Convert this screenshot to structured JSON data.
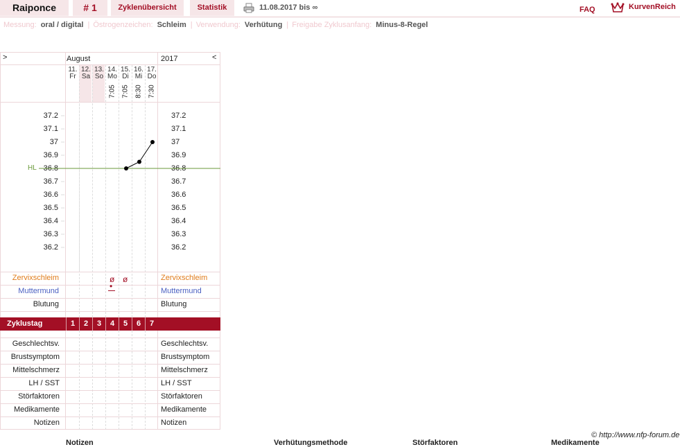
{
  "nav": {
    "user": "Raiponce",
    "cycle_number": "# 1",
    "tab_overview": "Zyklenübersicht",
    "tab_stats": "Statistik",
    "date_range": "11.08.2017 bis ∞",
    "faq": "FAQ",
    "brand": "KurvenReich"
  },
  "info": {
    "measure_label": "Messung:",
    "measure_value": "oral / digital",
    "estrogen_label": "Östrogenzeichen:",
    "estrogen_value": "Schleim",
    "use_label": "Verwendung:",
    "use_value": "Verhütung",
    "release_label": "Freigabe Zyklusanfang:",
    "release_value": "Minus-8-Regel"
  },
  "chart_header": {
    "nav_prev": ">",
    "month": "August",
    "year": "2017",
    "nav_next": "<"
  },
  "days": [
    {
      "date": "11.",
      "weekday": "Fr",
      "time": "",
      "cycle": "1"
    },
    {
      "date": "12.",
      "weekday": "Sa",
      "time": "",
      "cycle": "2"
    },
    {
      "date": "13.",
      "weekday": "So",
      "time": "",
      "cycle": "3"
    },
    {
      "date": "14.",
      "weekday": "Mo",
      "time": "7:05",
      "cycle": "4"
    },
    {
      "date": "15.",
      "weekday": "Di",
      "time": "7:05",
      "cycle": "5"
    },
    {
      "date": "16.",
      "weekday": "Mi",
      "time": "8:30",
      "cycle": "6"
    },
    {
      "date": "17.",
      "weekday": "Do",
      "time": "7:30",
      "cycle": "7"
    }
  ],
  "chart_data": {
    "type": "line",
    "x": [
      "11.",
      "12.",
      "13.",
      "14.",
      "15.",
      "16.",
      "17."
    ],
    "y": [
      null,
      null,
      null,
      null,
      36.8,
      36.85,
      37.0
    ],
    "yticks": [
      "37.2",
      "37.1",
      "37",
      "36.9",
      "36.8",
      "36.7",
      "36.6",
      "36.5",
      "36.4",
      "36.3",
      "36.2"
    ],
    "ylim": [
      36.2,
      37.2
    ],
    "hl_label": "HL",
    "hl_value": 36.8,
    "colors": {
      "hl_line": "#6a9a3a",
      "line": "#000000"
    }
  },
  "rows": {
    "cervix": "Zervixschleim",
    "cervix_marks": [
      "",
      "",
      "",
      "ø",
      "ø",
      "",
      ""
    ],
    "os": "Muttermund",
    "os_marks": [
      "",
      "",
      "",
      "•",
      "",
      "",
      ""
    ],
    "bleeding": "Blutung",
    "cycle_day": "Zyklustag",
    "sex": "Geschlechtsv.",
    "breast": "Brustsymptom",
    "midpain": "Mittelschmerz",
    "lh": "LH / SST",
    "disruptors": "Störfaktoren",
    "meds": "Medikamente",
    "notes": "Notizen"
  },
  "footer": {
    "copyright": "© http://www.nfp-forum.de",
    "col_notes": "Notizen",
    "col_method": "Verhütungsmethode",
    "col_disruptors": "Störfaktoren",
    "col_meds": "Medikamente"
  },
  "colors": {
    "brand": "#a30f25",
    "tab_bg": "#f6e6e8",
    "cervix": "#e07b1a",
    "os": "#4a5fc1"
  }
}
